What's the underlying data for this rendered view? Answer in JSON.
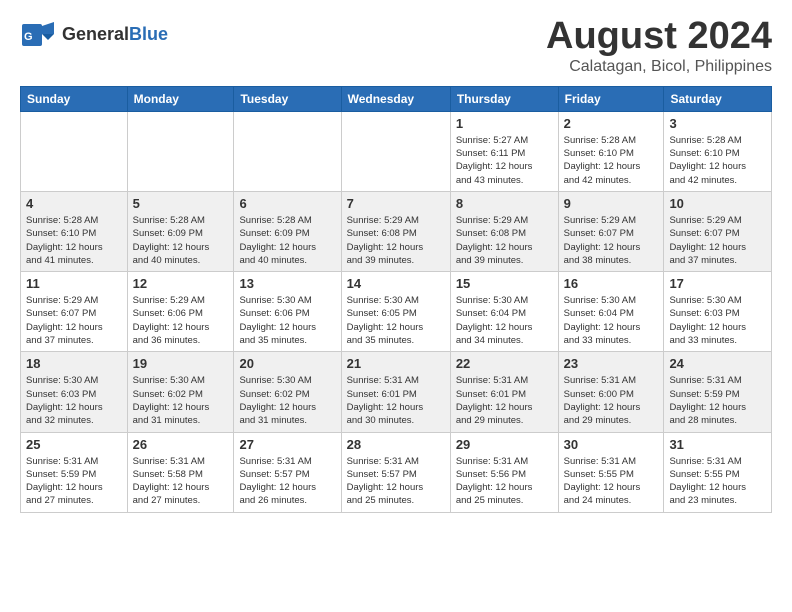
{
  "header": {
    "logo_general": "General",
    "logo_blue": "Blue",
    "calendar_title": "August 2024",
    "calendar_subtitle": "Calatagan, Bicol, Philippines"
  },
  "columns": [
    "Sunday",
    "Monday",
    "Tuesday",
    "Wednesday",
    "Thursday",
    "Friday",
    "Saturday"
  ],
  "rows": [
    {
      "cells": [
        {
          "num": "",
          "info": ""
        },
        {
          "num": "",
          "info": ""
        },
        {
          "num": "",
          "info": ""
        },
        {
          "num": "",
          "info": ""
        },
        {
          "num": "1",
          "info": "Sunrise: 5:27 AM\nSunset: 6:11 PM\nDaylight: 12 hours\nand 43 minutes."
        },
        {
          "num": "2",
          "info": "Sunrise: 5:28 AM\nSunset: 6:10 PM\nDaylight: 12 hours\nand 42 minutes."
        },
        {
          "num": "3",
          "info": "Sunrise: 5:28 AM\nSunset: 6:10 PM\nDaylight: 12 hours\nand 42 minutes."
        }
      ]
    },
    {
      "cells": [
        {
          "num": "4",
          "info": "Sunrise: 5:28 AM\nSunset: 6:10 PM\nDaylight: 12 hours\nand 41 minutes."
        },
        {
          "num": "5",
          "info": "Sunrise: 5:28 AM\nSunset: 6:09 PM\nDaylight: 12 hours\nand 40 minutes."
        },
        {
          "num": "6",
          "info": "Sunrise: 5:28 AM\nSunset: 6:09 PM\nDaylight: 12 hours\nand 40 minutes."
        },
        {
          "num": "7",
          "info": "Sunrise: 5:29 AM\nSunset: 6:08 PM\nDaylight: 12 hours\nand 39 minutes."
        },
        {
          "num": "8",
          "info": "Sunrise: 5:29 AM\nSunset: 6:08 PM\nDaylight: 12 hours\nand 39 minutes."
        },
        {
          "num": "9",
          "info": "Sunrise: 5:29 AM\nSunset: 6:07 PM\nDaylight: 12 hours\nand 38 minutes."
        },
        {
          "num": "10",
          "info": "Sunrise: 5:29 AM\nSunset: 6:07 PM\nDaylight: 12 hours\nand 37 minutes."
        }
      ]
    },
    {
      "cells": [
        {
          "num": "11",
          "info": "Sunrise: 5:29 AM\nSunset: 6:07 PM\nDaylight: 12 hours\nand 37 minutes."
        },
        {
          "num": "12",
          "info": "Sunrise: 5:29 AM\nSunset: 6:06 PM\nDaylight: 12 hours\nand 36 minutes."
        },
        {
          "num": "13",
          "info": "Sunrise: 5:30 AM\nSunset: 6:06 PM\nDaylight: 12 hours\nand 35 minutes."
        },
        {
          "num": "14",
          "info": "Sunrise: 5:30 AM\nSunset: 6:05 PM\nDaylight: 12 hours\nand 35 minutes."
        },
        {
          "num": "15",
          "info": "Sunrise: 5:30 AM\nSunset: 6:04 PM\nDaylight: 12 hours\nand 34 minutes."
        },
        {
          "num": "16",
          "info": "Sunrise: 5:30 AM\nSunset: 6:04 PM\nDaylight: 12 hours\nand 33 minutes."
        },
        {
          "num": "17",
          "info": "Sunrise: 5:30 AM\nSunset: 6:03 PM\nDaylight: 12 hours\nand 33 minutes."
        }
      ]
    },
    {
      "cells": [
        {
          "num": "18",
          "info": "Sunrise: 5:30 AM\nSunset: 6:03 PM\nDaylight: 12 hours\nand 32 minutes."
        },
        {
          "num": "19",
          "info": "Sunrise: 5:30 AM\nSunset: 6:02 PM\nDaylight: 12 hours\nand 31 minutes."
        },
        {
          "num": "20",
          "info": "Sunrise: 5:30 AM\nSunset: 6:02 PM\nDaylight: 12 hours\nand 31 minutes."
        },
        {
          "num": "21",
          "info": "Sunrise: 5:31 AM\nSunset: 6:01 PM\nDaylight: 12 hours\nand 30 minutes."
        },
        {
          "num": "22",
          "info": "Sunrise: 5:31 AM\nSunset: 6:01 PM\nDaylight: 12 hours\nand 29 minutes."
        },
        {
          "num": "23",
          "info": "Sunrise: 5:31 AM\nSunset: 6:00 PM\nDaylight: 12 hours\nand 29 minutes."
        },
        {
          "num": "24",
          "info": "Sunrise: 5:31 AM\nSunset: 5:59 PM\nDaylight: 12 hours\nand 28 minutes."
        }
      ]
    },
    {
      "cells": [
        {
          "num": "25",
          "info": "Sunrise: 5:31 AM\nSunset: 5:59 PM\nDaylight: 12 hours\nand 27 minutes."
        },
        {
          "num": "26",
          "info": "Sunrise: 5:31 AM\nSunset: 5:58 PM\nDaylight: 12 hours\nand 27 minutes."
        },
        {
          "num": "27",
          "info": "Sunrise: 5:31 AM\nSunset: 5:57 PM\nDaylight: 12 hours\nand 26 minutes."
        },
        {
          "num": "28",
          "info": "Sunrise: 5:31 AM\nSunset: 5:57 PM\nDaylight: 12 hours\nand 25 minutes."
        },
        {
          "num": "29",
          "info": "Sunrise: 5:31 AM\nSunset: 5:56 PM\nDaylight: 12 hours\nand 25 minutes."
        },
        {
          "num": "30",
          "info": "Sunrise: 5:31 AM\nSunset: 5:55 PM\nDaylight: 12 hours\nand 24 minutes."
        },
        {
          "num": "31",
          "info": "Sunrise: 5:31 AM\nSunset: 5:55 PM\nDaylight: 12 hours\nand 23 minutes."
        }
      ]
    }
  ]
}
